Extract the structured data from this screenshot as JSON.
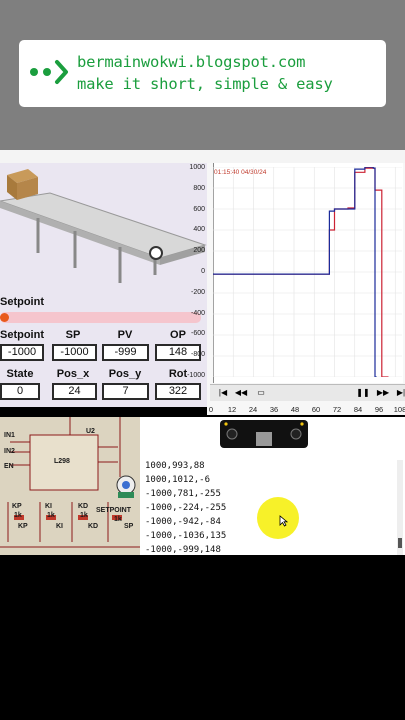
{
  "banner": {
    "line1": "bermainwokwi.blogspot.com",
    "line2": "make it short, simple & easy",
    "logo_color": "#1b9e3e"
  },
  "simulation": {
    "setpoint_label": "Setpoint",
    "slider_fraction": 0.0,
    "row1_headers": [
      "Setpoint",
      "SP",
      "PV",
      "OP"
    ],
    "row1_values": [
      "-1000",
      "-1000",
      "-999",
      "148"
    ],
    "row2_headers": [
      "State",
      "Pos_x",
      "Pos_y",
      "Rot"
    ],
    "row2_values": [
      "0",
      "24",
      "7",
      "322"
    ]
  },
  "chart": {
    "timestamp": "01:15:40  04/30/24",
    "y_ticks": [
      "1000",
      "800",
      "600",
      "400",
      "200",
      "0",
      "-200",
      "-400",
      "-600",
      "-800",
      "-1000"
    ],
    "x_ticks": [
      "0",
      "12",
      "24",
      "36",
      "48",
      "60",
      "72",
      "84",
      "96",
      "108"
    ],
    "controls": [
      "|◀",
      "◀◀",
      "▭",
      "❚❚",
      "▶▶",
      "▶|"
    ]
  },
  "chart_data": {
    "type": "line",
    "title": "",
    "xlabel": "",
    "ylabel": "",
    "xlim": [
      0,
      112
    ],
    "ylim": [
      -1000,
      1000
    ],
    "series": [
      {
        "color": "#cc2233",
        "x": [
          0,
          69,
          69,
          72,
          72,
          80,
          80,
          84,
          84,
          90,
          90,
          96,
          96,
          100,
          100,
          104
        ],
        "y": [
          -20,
          -20,
          400,
          400,
          600,
          600,
          610,
          610,
          950,
          950,
          990,
          990,
          780,
          780,
          -1000,
          -1000
        ]
      },
      {
        "color": "#1a2a9a",
        "x": [
          0,
          69,
          69,
          72,
          72,
          84,
          84,
          90,
          90,
          95,
          95,
          96,
          96,
          97
        ],
        "y": [
          -20,
          -20,
          580,
          580,
          600,
          600,
          980,
          980,
          1000,
          1000,
          990,
          990,
          -1000,
          -1000
        ]
      }
    ]
  },
  "circuit": {
    "labels": [
      "U2",
      "IN1",
      "IN2",
      "EN",
      "L298",
      "KP",
      "1k",
      "KI",
      "1k",
      "KD",
      "1k",
      "SETPOINT",
      "1k",
      "KP",
      "KI",
      "KD",
      "SP"
    ]
  },
  "serial": {
    "lines": [
      "1000,993,88",
      "1000,1012,-6",
      "-1000,781,-255",
      "-1000,-224,-255",
      "-1000,-942,-84",
      "-1000,-1036,135",
      "-1000,-999,148"
    ]
  }
}
